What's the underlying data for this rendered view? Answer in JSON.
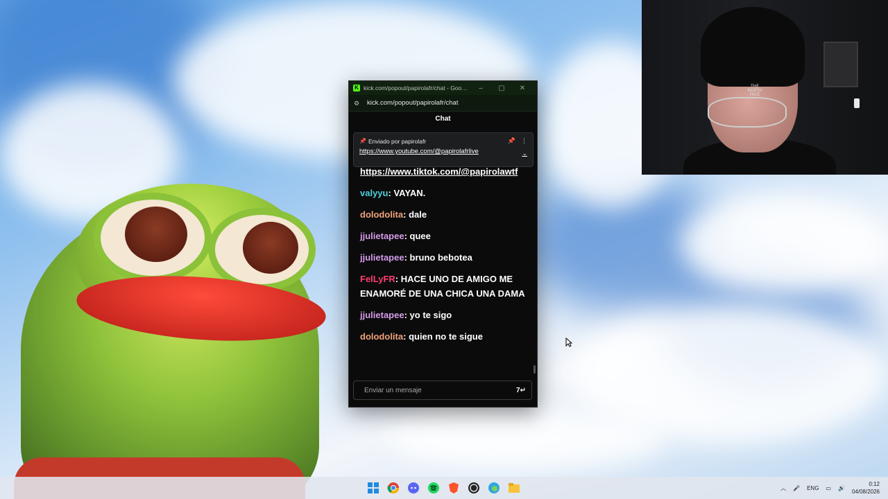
{
  "browser": {
    "title": "kick.com/popout/papirolafr/chat - Google C...",
    "url": "kick.com/popout/papirolafr/chat"
  },
  "chat": {
    "header": "Chat",
    "pinned": {
      "label": "Enviado por papirolafr",
      "link": "https://www.youtube.com/@papirolafrlive"
    },
    "messages": [
      {
        "user": "",
        "user_color": "#ffffff",
        "text": "https://www.tiktok.com/@papirolawtf",
        "is_link": true
      },
      {
        "user": "valyyu",
        "user_color": "#4fd1d9",
        "text": "VAYAN."
      },
      {
        "user": "dolodolita",
        "user_color": "#f0a27a",
        "text": "dale"
      },
      {
        "user": "jjulietapee",
        "user_color": "#d49be8",
        "text": "quee"
      },
      {
        "user": "jjulietapee",
        "user_color": "#d49be8",
        "text": "bruno bebotea"
      },
      {
        "user": "FelLyFR",
        "user_color": "#ff3d6e",
        "text": "HACE UNO DE AMIGO ME ENAMORÉ DE UNA CHICA UNA DAMA"
      },
      {
        "user": "jjulietapee",
        "user_color": "#d49be8",
        "text": "yo te sigo"
      },
      {
        "user": "dolodolita",
        "user_color": "#f0a27a",
        "text": "quien no te sigue"
      }
    ],
    "input_placeholder": "Enviar un mensaje"
  },
  "taskbar": {
    "apps": [
      "windows-start-icon",
      "chrome-icon",
      "discord-icon",
      "spotify-icon",
      "brave-icon",
      "obs-icon",
      "edge-icon",
      "file-explorer-icon"
    ],
    "lang": "ENG",
    "time": "0:12",
    "date": "04/08/2026"
  },
  "colors": {
    "kick_green": "#53fc18",
    "chat_bg": "#0b0b0c"
  }
}
